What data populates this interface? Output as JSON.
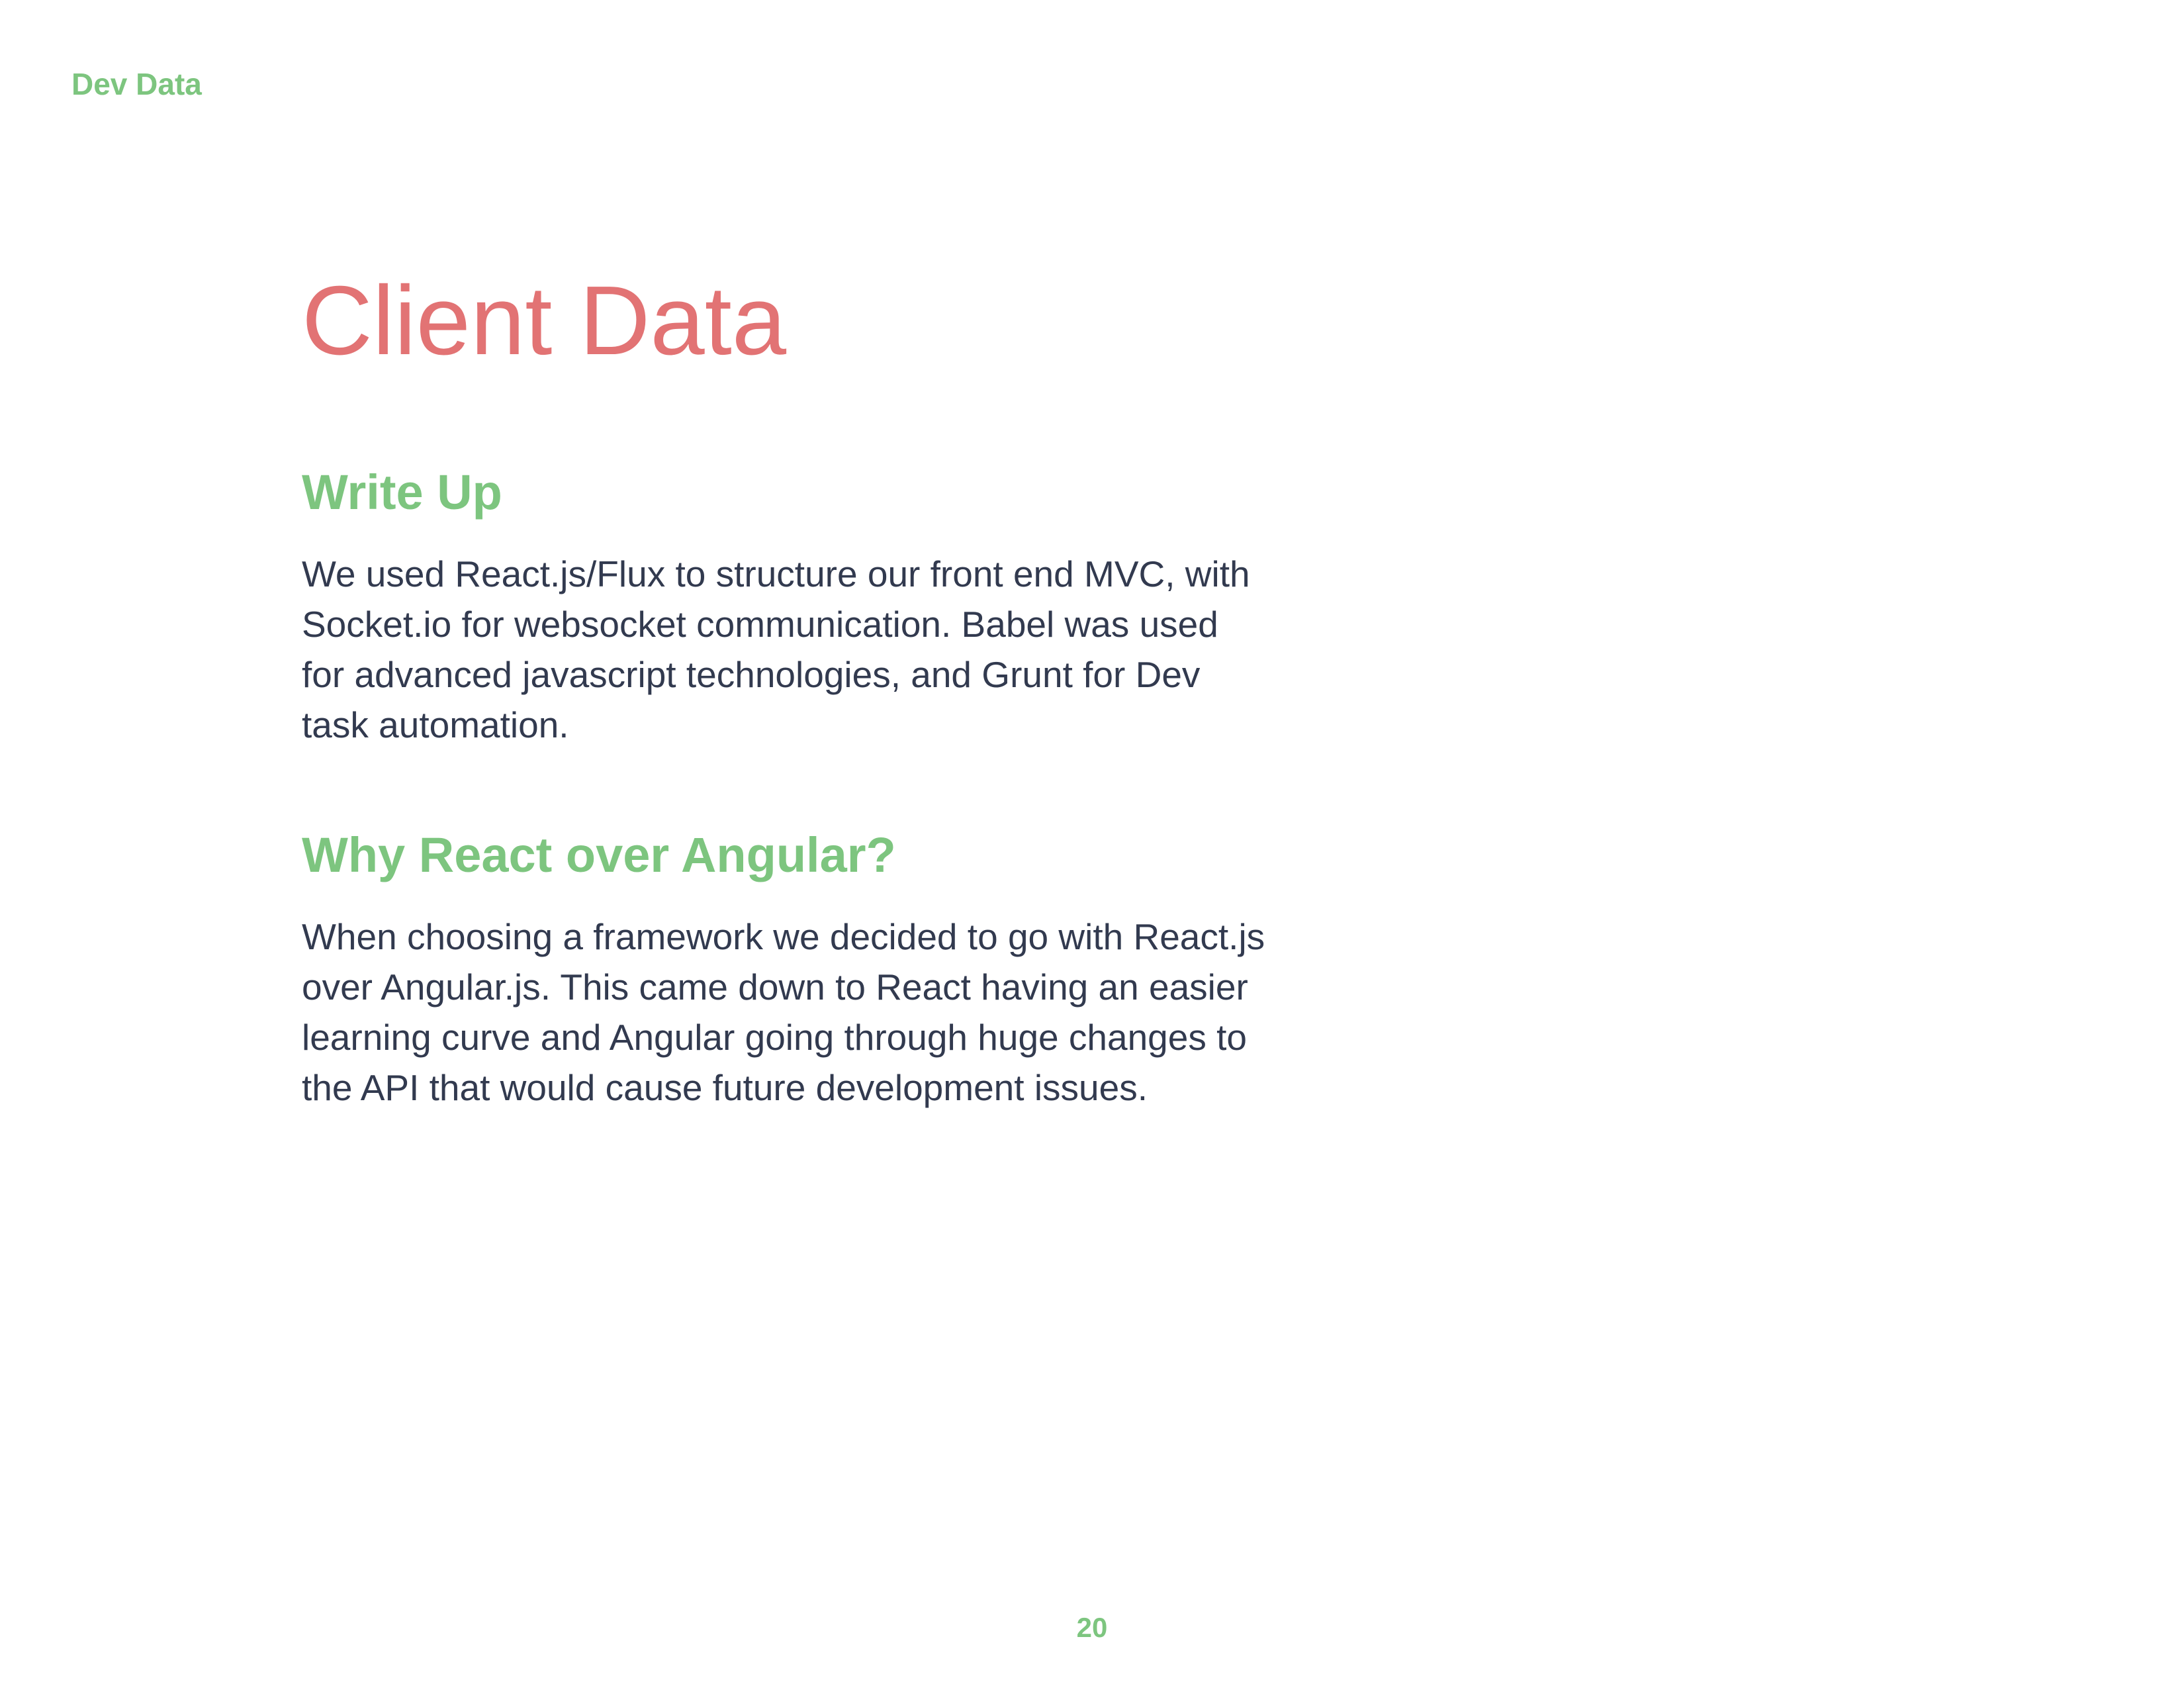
{
  "header": {
    "running_title": "Dev Data"
  },
  "page": {
    "title": "Client Data",
    "number": "20"
  },
  "sections": [
    {
      "heading": "Write Up",
      "body": "We used React.js/Flux to structure our front end MVC, with Socket.io for websocket communication. Babel was used for advanced javascript technologies, and Grunt for Dev task automation."
    },
    {
      "heading": "Why React over Angular?",
      "body": "When choosing a framework we decided to go with React.js over Angular.js. This came down to React having an easier learning curve and Angular going through huge changes to the API that would cause future development issues."
    }
  ],
  "colors": {
    "accent_green": "#7dc57f",
    "title_red": "#e27374",
    "body_text": "#323a4f",
    "background": "#ffffff"
  }
}
